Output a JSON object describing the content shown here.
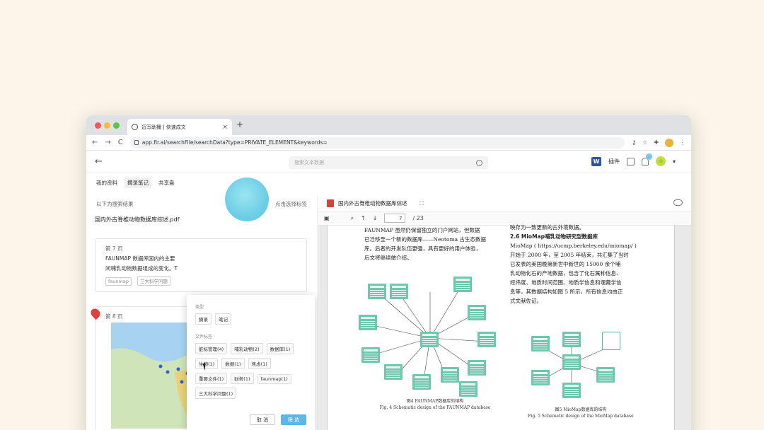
{
  "browser": {
    "tab_title": "迈写助播 | 快速成文",
    "tab_close": "×",
    "new_tab": "+",
    "back": "←",
    "forward": "→",
    "reload": "C",
    "url": "app.fir.ai/searchFile/searchData?type=PRIVATE_ELEMENT&keywords=",
    "key_icon": "⚷",
    "star_icon": "☆",
    "puzzle_icon": "✚",
    "menu": "⋮"
  },
  "app_header": {
    "back": "←",
    "search_placeholder": "搜索文本数据",
    "plugin_label": "插件",
    "word_letter": "W",
    "avatar_text": "ıİı",
    "avatar_caret": "▾"
  },
  "subnav": {
    "tabs": [
      "我的资料",
      "摘录笔记",
      "共享盘"
    ]
  },
  "left_panel": {
    "header_left": "以下为搜索结果",
    "header_right": "点击选择标签",
    "doc_name": "国内外古脊椎动物数据库综述.pdf",
    "card1": {
      "page": "第 7 页",
      "line1": "FAUNMAP 数据库国内的主要",
      "line2": "间哺乳动物数据组成的变化。T",
      "chips": [
        "faunmap",
        "三大科学问题"
      ]
    },
    "card2": {
      "page": "第 8 页"
    }
  },
  "filter_popup": {
    "type_label": "类型",
    "type_options": [
      "摘录",
      "笔记"
    ],
    "tag_label": "文件标签",
    "tags": [
      "脏标管理(4)",
      "哺乳动物(2)",
      "数据库(1)",
      "生物(1)",
      "数据(1)",
      "焦虑(1)",
      "重要文件(1)",
      "财务(1)",
      "faunmap(1)",
      "三大科学问题(1)"
    ],
    "cancel": "取 消",
    "confirm": "筛 选"
  },
  "pdf_viewer": {
    "title": "国内外古脊椎动物数据库综述",
    "page_input": "7",
    "page_total": "/ 23",
    "left_col": [
      "FAUNMAP 虽然仍保留独立的门户网站，但数据",
      "已迁移至一个新的数据库——Neotoma 古生态数据",
      "库。后者的开发队伍更强，具有更好的用户体验，",
      "后文将继续做介绍。"
    ],
    "right_top": "映存为一致更新的古外境数据。",
    "section_heading": "2.6   MioMap哺乳动物研究型数据库",
    "right_col": [
      "MioMap ( https://ucmp.berkeley.edu/miomap/ )",
      "开始于 2000 年，至 2005 年结束，共汇集了当时",
      "已发表的美国晚第新世中新世的 15000 余个哺",
      "乳动物化石的产地数据，包含了化石属种信息、",
      "经纬度、地质时间范围、地质学信息和埋藏学信",
      "息等，其数据结构如图 5 所示，所有信息均由正",
      "式文献佐证。"
    ],
    "fig4_cn": "图4    FAUNMAP数据库的结构",
    "fig4_en": "Fig. 4    Schematic design of the FAUNMAP database",
    "fig5_cn": "图5    MioMap数据库的结构",
    "fig5_en": "Fig. 5    Schematic design of the MioMap database"
  },
  "colors": {
    "page_bg": "#fbf6e9",
    "accent": "#5cb6e6",
    "diagram_teal": "#6fc7ad"
  }
}
